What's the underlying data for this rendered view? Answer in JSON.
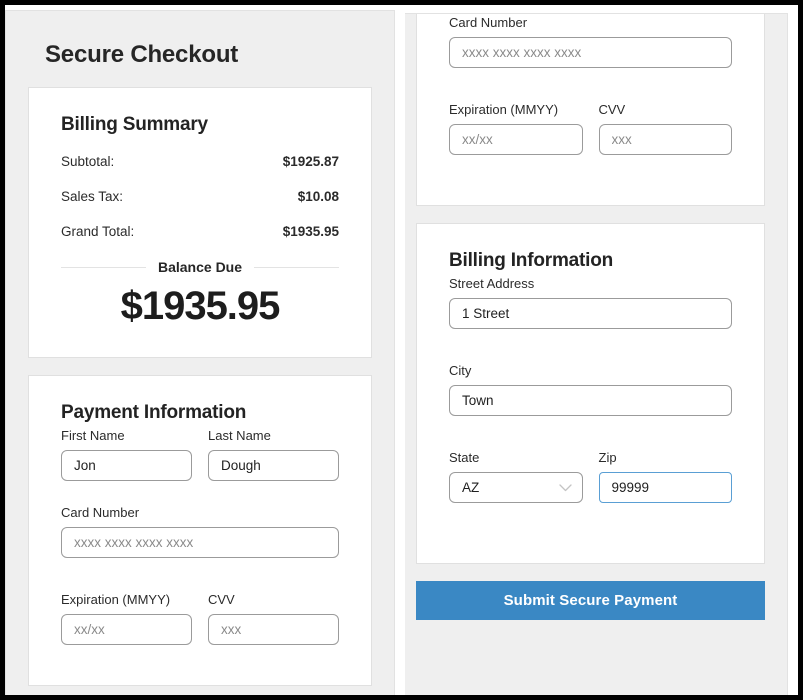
{
  "page": {
    "title": "Secure Checkout"
  },
  "billing_summary": {
    "heading": "Billing Summary",
    "rows": [
      {
        "label": "Subtotal:",
        "value": "$1925.87"
      },
      {
        "label": "Sales Tax:",
        "value": "$10.08"
      },
      {
        "label": "Grand Total:",
        "value": "$1935.95"
      }
    ],
    "balance_legend": "Balance Due",
    "balance_amount": "$1935.95"
  },
  "payment_information": {
    "heading": "Payment Information",
    "first_name": {
      "label": "First Name",
      "value": "Jon",
      "placeholder": ""
    },
    "last_name": {
      "label": "Last Name",
      "value": "Dough",
      "placeholder": ""
    },
    "card_number": {
      "label": "Card Number",
      "value": "",
      "placeholder": "xxxx xxxx xxxx xxxx"
    },
    "expiration": {
      "label": "Expiration (MMYY)",
      "value": "",
      "placeholder": "xx/xx"
    },
    "cvv": {
      "label": "CVV",
      "value": "",
      "placeholder": "xxx"
    }
  },
  "payment_information_right": {
    "card_number": {
      "label": "Card Number",
      "value": "",
      "placeholder": "xxxx xxxx xxxx xxxx"
    },
    "expiration": {
      "label": "Expiration (MMYY)",
      "value": "",
      "placeholder": "xx/xx"
    },
    "cvv": {
      "label": "CVV",
      "value": "",
      "placeholder": "xxx"
    }
  },
  "billing_information": {
    "heading": "Billing Information",
    "street_address": {
      "label": "Street Address",
      "value": "1 Street",
      "placeholder": ""
    },
    "city": {
      "label": "City",
      "value": "Town",
      "placeholder": ""
    },
    "state": {
      "label": "State",
      "value": "AZ",
      "icon": "chevron-down-icon"
    },
    "zip": {
      "label": "Zip",
      "value": "99999",
      "placeholder": "",
      "focused": true
    }
  },
  "actions": {
    "submit_label": "Submit Secure Payment"
  },
  "colors": {
    "accent": "#3a88c4",
    "focus_border": "#5a9fd4",
    "panel_bg": "#efefef",
    "card_bg": "#ffffff",
    "text": "#262626"
  }
}
